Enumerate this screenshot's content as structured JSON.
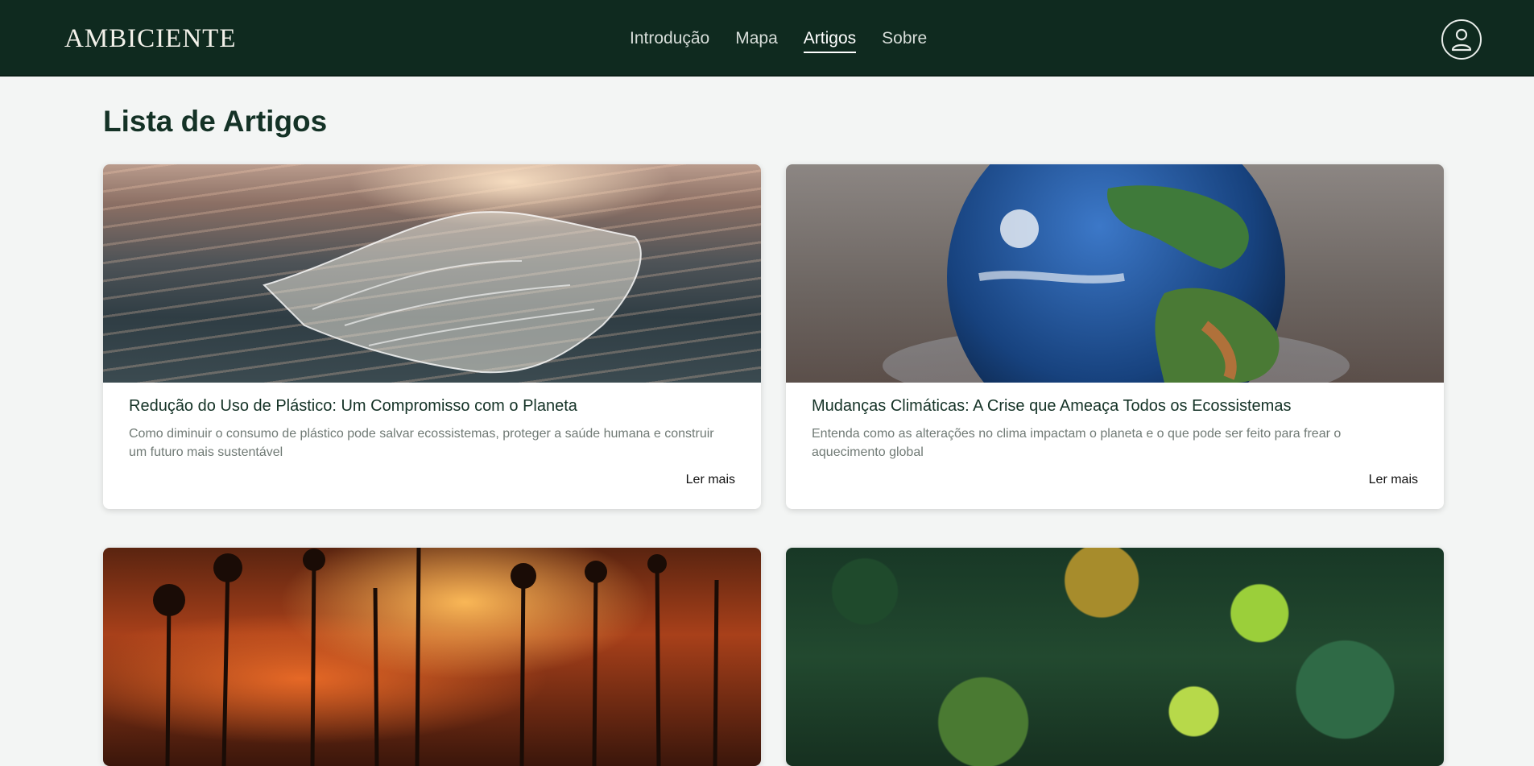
{
  "header": {
    "logo": "AMBICIENTE",
    "nav": [
      {
        "label": "Introdução",
        "active": false
      },
      {
        "label": "Mapa",
        "active": false
      },
      {
        "label": "Artigos",
        "active": true
      },
      {
        "label": "Sobre",
        "active": false
      }
    ],
    "account_icon": "user-icon"
  },
  "main": {
    "title": "Lista de Artigos",
    "articles": [
      {
        "title": "Redução do Uso de Plástico: Um Compromisso com o Planeta",
        "description": "Como diminuir o consumo de plástico pode salvar ecossistemas, proteger a saúde humana e construir um futuro mais sustentável",
        "read_more": "Ler mais"
      },
      {
        "title": "Mudanças Climáticas: A Crise que Ameaça Todos os Ecossistemas",
        "description": "Entenda como as alterações no clima impactam o planeta e o que pode ser feito para frear o aquecimento global",
        "read_more": "Ler mais"
      },
      {},
      {}
    ]
  },
  "colors": {
    "header_bg": "#0f2a1f",
    "page_bg": "#f3f5f4",
    "title": "#143226",
    "muted_text": "#707a75"
  }
}
